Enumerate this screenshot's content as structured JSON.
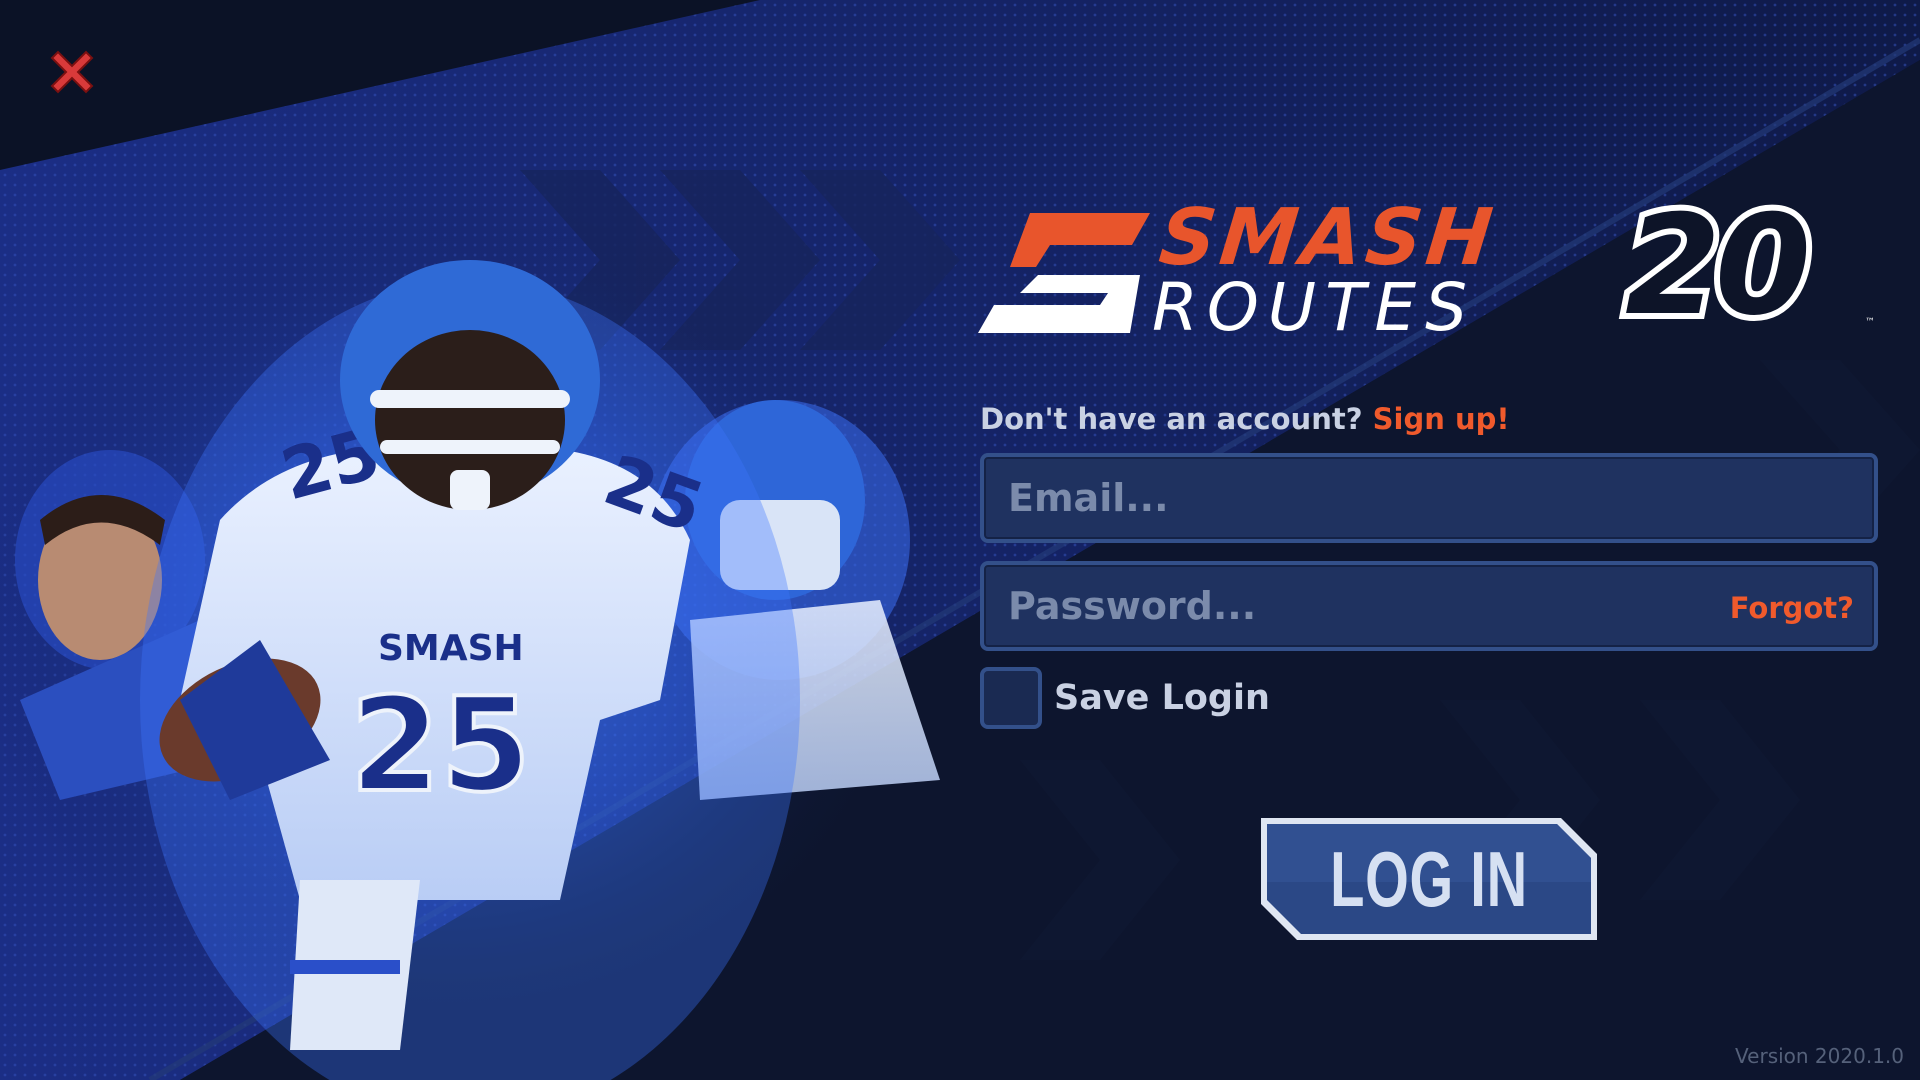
{
  "window": {
    "close_icon": "close-x-icon",
    "close_color": "#d93a3a"
  },
  "logo": {
    "smash": "SMASH",
    "routes": "ROUTES",
    "year": "20",
    "tm": "™",
    "accent_color": "#e8552c"
  },
  "signup": {
    "prompt": "Don't have an account?",
    "link": "Sign up!"
  },
  "login_form": {
    "email_placeholder": "Email...",
    "email_value": "",
    "password_placeholder": "Password...",
    "password_value": "",
    "forgot_label": "Forgot?",
    "save_login_label": "Save Login",
    "save_login_checked": false,
    "login_button_label": "LOG IN"
  },
  "artwork": {
    "jersey_text": "SMASH",
    "jersey_number": "25"
  },
  "footer": {
    "version": "Version 2020.1.0"
  },
  "colors": {
    "background": "#0b1226",
    "field_fill": "#1f3260",
    "field_border": "#33508a",
    "link": "#f05a2c"
  }
}
